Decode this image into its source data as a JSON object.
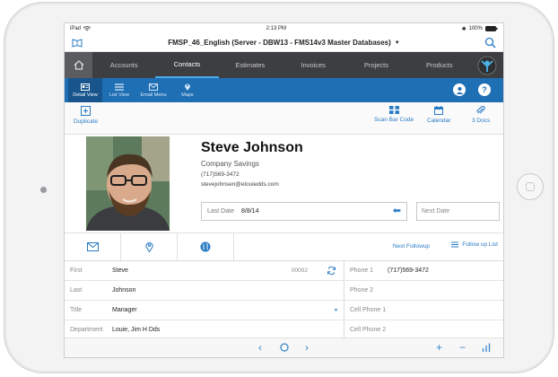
{
  "statusbar": {
    "device": "iPad",
    "time": "2:13 PM",
    "battery": "100%"
  },
  "window": {
    "title": "FMSP_46_English (Server - DBW13 - FMS14v3 Master Databases)"
  },
  "nav": {
    "tabs": [
      {
        "label": "Accounts"
      },
      {
        "label": "Contacts"
      },
      {
        "label": "Estimates"
      },
      {
        "label": "Invoices"
      },
      {
        "label": "Projects"
      },
      {
        "label": "Products"
      }
    ],
    "active": "Contacts"
  },
  "toolbar": {
    "items": [
      {
        "label": "Detail View"
      },
      {
        "label": "List View"
      },
      {
        "label": "Email Menu"
      },
      {
        "label": "Maps"
      }
    ]
  },
  "actions": {
    "duplicate": "Duplicate",
    "scan": "Scan Bar Code",
    "calendar": "Calendar",
    "docs": "3 Docs"
  },
  "contact": {
    "name": "Steve Johnson",
    "company": "Company Savings",
    "phone": "(717)569-3472",
    "email": "stevejohnsen@elouiedds.com",
    "last_date_label": "Last Date",
    "last_date": "8/8/14",
    "next_date_label": "Next Date"
  },
  "followup": {
    "next": "Next Followup",
    "list": "Follow up List"
  },
  "fields": {
    "left": [
      {
        "label": "First",
        "value": "Steve",
        "extra": "00002"
      },
      {
        "label": "Last",
        "value": "Johnson"
      },
      {
        "label": "Title",
        "value": "Manager"
      },
      {
        "label": "Department",
        "value": "Louie, Jim H Dds"
      }
    ],
    "right": [
      {
        "label": "Phone 1",
        "value": "(717)569-3472"
      },
      {
        "label": "Phone 2",
        "value": ""
      },
      {
        "label": "Cell Phone 1",
        "value": ""
      },
      {
        "label": "Cell Phone 2",
        "value": ""
      }
    ]
  },
  "colors": {
    "toolbar": "#1f6fb5",
    "nav": "#3d3e41",
    "accent": "#2a7bc4"
  }
}
